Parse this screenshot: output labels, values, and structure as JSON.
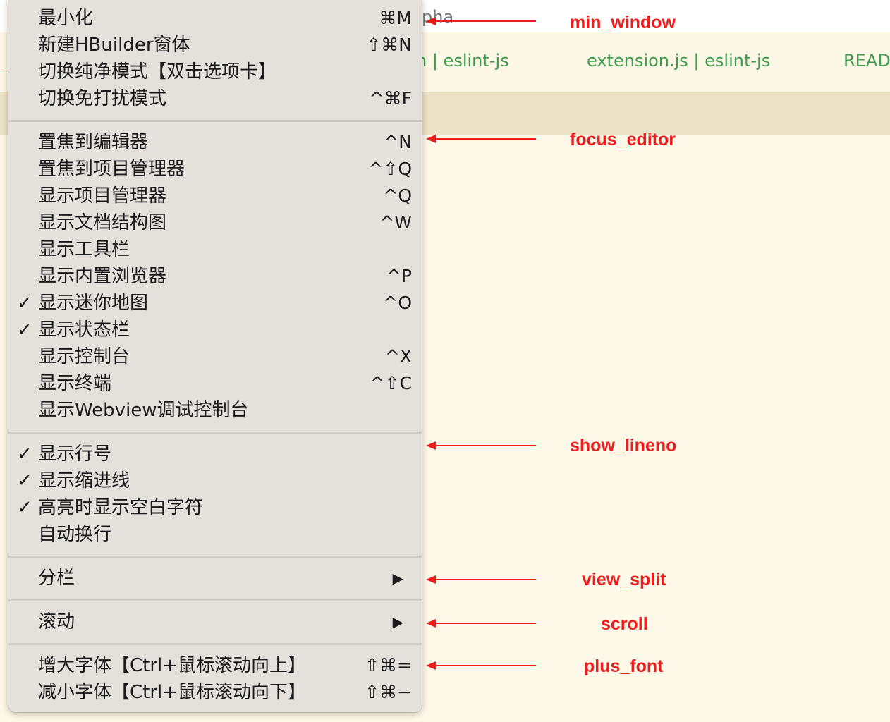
{
  "window": {
    "title_fragment": "pha",
    "tabs": [
      {
        "label": "n | eslint-js"
      },
      {
        "label": "extension.js | eslint-js"
      },
      {
        "label": "READ"
      }
    ]
  },
  "menu": {
    "items": [
      {
        "label": "最小化",
        "shortcut": "⌘M",
        "checked": false
      },
      {
        "label": "新建HBuilder窗体",
        "shortcut": "⇧⌘N",
        "checked": false
      },
      {
        "label": "切换纯净模式【双击选项卡】",
        "shortcut": "",
        "checked": false
      },
      {
        "label": "切换免打扰模式",
        "shortcut": "^⌘F",
        "checked": false
      },
      {
        "label": "置焦到编辑器",
        "shortcut": "^N",
        "checked": false
      },
      {
        "label": "置焦到项目管理器",
        "shortcut": "^⇧Q",
        "checked": false
      },
      {
        "label": "显示项目管理器",
        "shortcut": "^Q",
        "checked": false
      },
      {
        "label": "显示文档结构图",
        "shortcut": "^W",
        "checked": false
      },
      {
        "label": "显示工具栏",
        "shortcut": "",
        "checked": false
      },
      {
        "label": "显示内置浏览器",
        "shortcut": "^P",
        "checked": false
      },
      {
        "label": "显示迷你地图",
        "shortcut": "^O",
        "checked": true
      },
      {
        "label": "显示状态栏",
        "shortcut": "",
        "checked": true
      },
      {
        "label": "显示控制台",
        "shortcut": "^X",
        "checked": false
      },
      {
        "label": "显示终端",
        "shortcut": "^⇧C",
        "checked": false
      },
      {
        "label": "显示Webview调试控制台",
        "shortcut": "",
        "checked": false
      },
      {
        "label": "显示行号",
        "shortcut": "",
        "checked": true
      },
      {
        "label": "显示缩进线",
        "shortcut": "",
        "checked": true
      },
      {
        "label": "高亮时显示空白字符",
        "shortcut": "",
        "checked": true
      },
      {
        "label": "自动换行",
        "shortcut": "",
        "checked": false
      },
      {
        "label": "分栏",
        "submenu_arrow": "▶"
      },
      {
        "label": "滚动",
        "submenu_arrow": "▶"
      },
      {
        "label": "增大字体【Ctrl+鼠标滚动向上】",
        "shortcut": "⇧⌘=",
        "checked": false
      },
      {
        "label": "减小字体【Ctrl+鼠标滚动向下】",
        "shortcut": "⇧⌘−",
        "checked": false
      }
    ],
    "check_glyph": "✓"
  },
  "annotations": [
    {
      "label": "min_window",
      "color": "#ee1c1c"
    },
    {
      "label": "focus_editor",
      "color": "#ee1c1c"
    },
    {
      "label": "show_lineno",
      "color": "#ee1c1c"
    },
    {
      "label": "view_split",
      "color": "#ee1c1c"
    },
    {
      "label": "scroll",
      "color": "#ee1c1c"
    },
    {
      "label": "plus_font",
      "color": "#ee1c1c"
    }
  ],
  "colors": {
    "editor_background": "#fdf8e8",
    "tab_text": "#3e9b4f",
    "menu_background": "#e4e1dd",
    "annotation": "#ee1c1c"
  }
}
